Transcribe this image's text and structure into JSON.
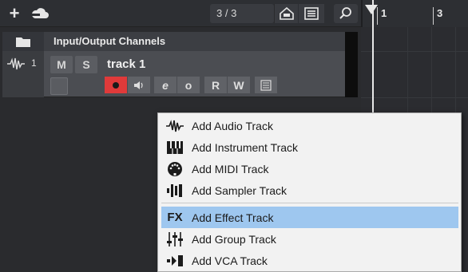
{
  "toolbar": {
    "add_icon": "plus-icon",
    "cloud_icon": "cloud-icon",
    "counter": "3 / 3",
    "home_icon": "home-icon",
    "list_icon": "list-icon",
    "search_icon": "search-icon"
  },
  "ruler": {
    "marks": [
      "1",
      "3"
    ]
  },
  "folder_track": {
    "label": "Input/Output Channels"
  },
  "track": {
    "number": "1",
    "mute": "M",
    "solo": "S",
    "name": "track 1",
    "read": "R",
    "write": "W",
    "edit": "e",
    "monitor": "o",
    "colors": {
      "record": "#e03a3a"
    }
  },
  "menu": {
    "items": [
      {
        "label": "Add Audio Track",
        "icon": "audio-wave-icon"
      },
      {
        "label": "Add Instrument Track",
        "icon": "piano-keys-icon"
      },
      {
        "label": "Add MIDI Track",
        "icon": "midi-connector-icon"
      },
      {
        "label": "Add Sampler Track",
        "icon": "sampler-icon"
      },
      {
        "label": "Add Effect Track",
        "icon": "fx-icon",
        "icon_text": "FX",
        "selected": true
      },
      {
        "label": "Add Group Track",
        "icon": "group-faders-icon"
      },
      {
        "label": "Add VCA Track",
        "icon": "vca-icon"
      }
    ],
    "highlight_color": "#9ec7ef"
  }
}
